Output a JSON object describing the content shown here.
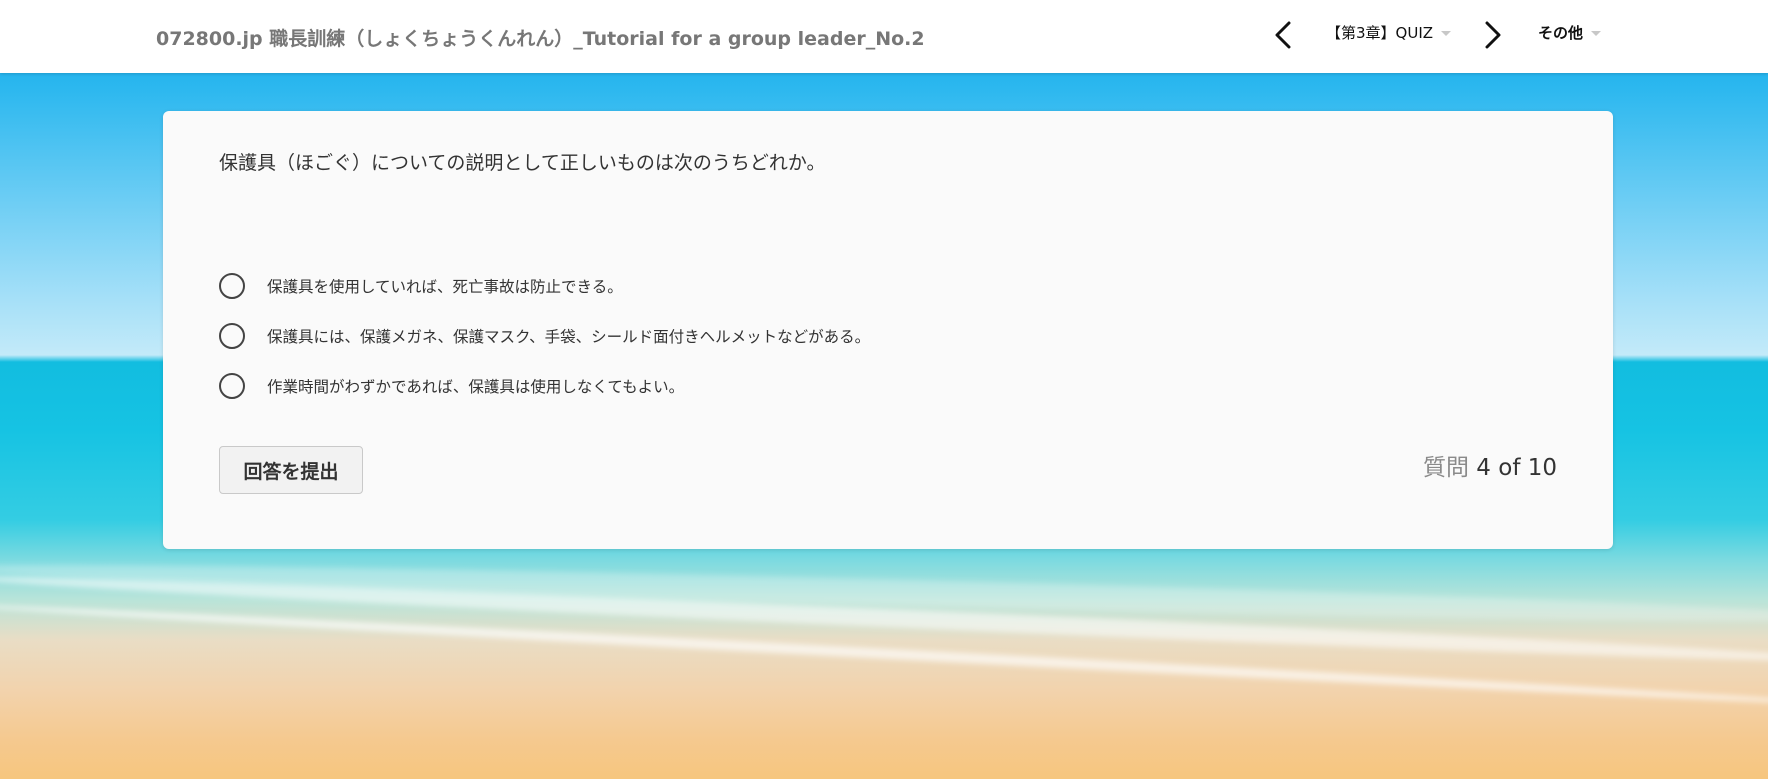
{
  "header": {
    "course_title": "072800.jp 職長訓練（しょくちょうくんれん）_Tutorial for a group leader_No.2",
    "lesson_dropdown_label": "【第3章】QUIZ",
    "other_dropdown_label": "その他"
  },
  "quiz": {
    "question": "保護具（ほごぐ）についての説明として正しいものは次のうちどれか。",
    "choices": [
      {
        "label": "保護具を使用していれば、死亡事故は防止できる。"
      },
      {
        "label": "保護具には、保護メガネ、保護マスク、手袋、シールド面付きヘルメットなどがある。"
      },
      {
        "label": "作業時間がわずかであれば、保護具は使用しなくてもよい。"
      }
    ],
    "submit_label": "回答を提出",
    "progress_label": "質問",
    "progress_value": "4 of 10"
  },
  "icons": {
    "prev": "chevron-left-icon",
    "next": "chevron-right-icon",
    "dropdown": "caret-down-icon"
  },
  "colors": {
    "header_bg": "#ffffff",
    "card_bg": "#fafafa",
    "title_text": "#777777"
  }
}
